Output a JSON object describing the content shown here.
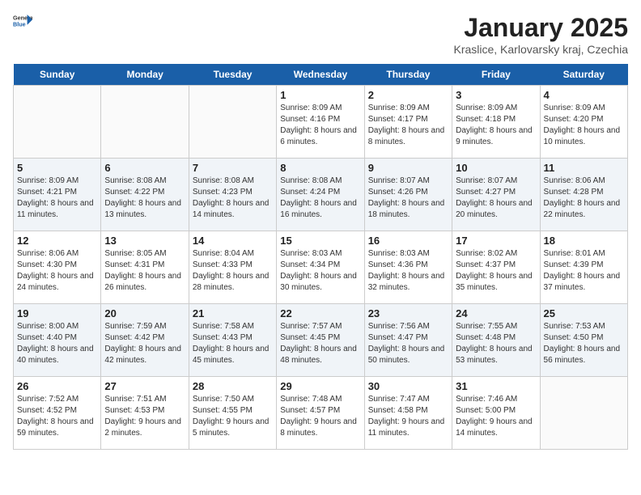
{
  "logo": {
    "general": "General",
    "blue": "Blue"
  },
  "title": "January 2025",
  "subtitle": "Kraslice, Karlovarsky kraj, Czechia",
  "days": [
    "Sunday",
    "Monday",
    "Tuesday",
    "Wednesday",
    "Thursday",
    "Friday",
    "Saturday"
  ],
  "weeks": [
    [
      {
        "date": "",
        "text": ""
      },
      {
        "date": "",
        "text": ""
      },
      {
        "date": "",
        "text": ""
      },
      {
        "date": "1",
        "text": "Sunrise: 8:09 AM\nSunset: 4:16 PM\nDaylight: 8 hours and 6 minutes."
      },
      {
        "date": "2",
        "text": "Sunrise: 8:09 AM\nSunset: 4:17 PM\nDaylight: 8 hours and 8 minutes."
      },
      {
        "date": "3",
        "text": "Sunrise: 8:09 AM\nSunset: 4:18 PM\nDaylight: 8 hours and 9 minutes."
      },
      {
        "date": "4",
        "text": "Sunrise: 8:09 AM\nSunset: 4:20 PM\nDaylight: 8 hours and 10 minutes."
      }
    ],
    [
      {
        "date": "5",
        "text": "Sunrise: 8:09 AM\nSunset: 4:21 PM\nDaylight: 8 hours and 11 minutes."
      },
      {
        "date": "6",
        "text": "Sunrise: 8:08 AM\nSunset: 4:22 PM\nDaylight: 8 hours and 13 minutes."
      },
      {
        "date": "7",
        "text": "Sunrise: 8:08 AM\nSunset: 4:23 PM\nDaylight: 8 hours and 14 minutes."
      },
      {
        "date": "8",
        "text": "Sunrise: 8:08 AM\nSunset: 4:24 PM\nDaylight: 8 hours and 16 minutes."
      },
      {
        "date": "9",
        "text": "Sunrise: 8:07 AM\nSunset: 4:26 PM\nDaylight: 8 hours and 18 minutes."
      },
      {
        "date": "10",
        "text": "Sunrise: 8:07 AM\nSunset: 4:27 PM\nDaylight: 8 hours and 20 minutes."
      },
      {
        "date": "11",
        "text": "Sunrise: 8:06 AM\nSunset: 4:28 PM\nDaylight: 8 hours and 22 minutes."
      }
    ],
    [
      {
        "date": "12",
        "text": "Sunrise: 8:06 AM\nSunset: 4:30 PM\nDaylight: 8 hours and 24 minutes."
      },
      {
        "date": "13",
        "text": "Sunrise: 8:05 AM\nSunset: 4:31 PM\nDaylight: 8 hours and 26 minutes."
      },
      {
        "date": "14",
        "text": "Sunrise: 8:04 AM\nSunset: 4:33 PM\nDaylight: 8 hours and 28 minutes."
      },
      {
        "date": "15",
        "text": "Sunrise: 8:03 AM\nSunset: 4:34 PM\nDaylight: 8 hours and 30 minutes."
      },
      {
        "date": "16",
        "text": "Sunrise: 8:03 AM\nSunset: 4:36 PM\nDaylight: 8 hours and 32 minutes."
      },
      {
        "date": "17",
        "text": "Sunrise: 8:02 AM\nSunset: 4:37 PM\nDaylight: 8 hours and 35 minutes."
      },
      {
        "date": "18",
        "text": "Sunrise: 8:01 AM\nSunset: 4:39 PM\nDaylight: 8 hours and 37 minutes."
      }
    ],
    [
      {
        "date": "19",
        "text": "Sunrise: 8:00 AM\nSunset: 4:40 PM\nDaylight: 8 hours and 40 minutes."
      },
      {
        "date": "20",
        "text": "Sunrise: 7:59 AM\nSunset: 4:42 PM\nDaylight: 8 hours and 42 minutes."
      },
      {
        "date": "21",
        "text": "Sunrise: 7:58 AM\nSunset: 4:43 PM\nDaylight: 8 hours and 45 minutes."
      },
      {
        "date": "22",
        "text": "Sunrise: 7:57 AM\nSunset: 4:45 PM\nDaylight: 8 hours and 48 minutes."
      },
      {
        "date": "23",
        "text": "Sunrise: 7:56 AM\nSunset: 4:47 PM\nDaylight: 8 hours and 50 minutes."
      },
      {
        "date": "24",
        "text": "Sunrise: 7:55 AM\nSunset: 4:48 PM\nDaylight: 8 hours and 53 minutes."
      },
      {
        "date": "25",
        "text": "Sunrise: 7:53 AM\nSunset: 4:50 PM\nDaylight: 8 hours and 56 minutes."
      }
    ],
    [
      {
        "date": "26",
        "text": "Sunrise: 7:52 AM\nSunset: 4:52 PM\nDaylight: 8 hours and 59 minutes."
      },
      {
        "date": "27",
        "text": "Sunrise: 7:51 AM\nSunset: 4:53 PM\nDaylight: 9 hours and 2 minutes."
      },
      {
        "date": "28",
        "text": "Sunrise: 7:50 AM\nSunset: 4:55 PM\nDaylight: 9 hours and 5 minutes."
      },
      {
        "date": "29",
        "text": "Sunrise: 7:48 AM\nSunset: 4:57 PM\nDaylight: 9 hours and 8 minutes."
      },
      {
        "date": "30",
        "text": "Sunrise: 7:47 AM\nSunset: 4:58 PM\nDaylight: 9 hours and 11 minutes."
      },
      {
        "date": "31",
        "text": "Sunrise: 7:46 AM\nSunset: 5:00 PM\nDaylight: 9 hours and 14 minutes."
      },
      {
        "date": "",
        "text": ""
      }
    ]
  ]
}
